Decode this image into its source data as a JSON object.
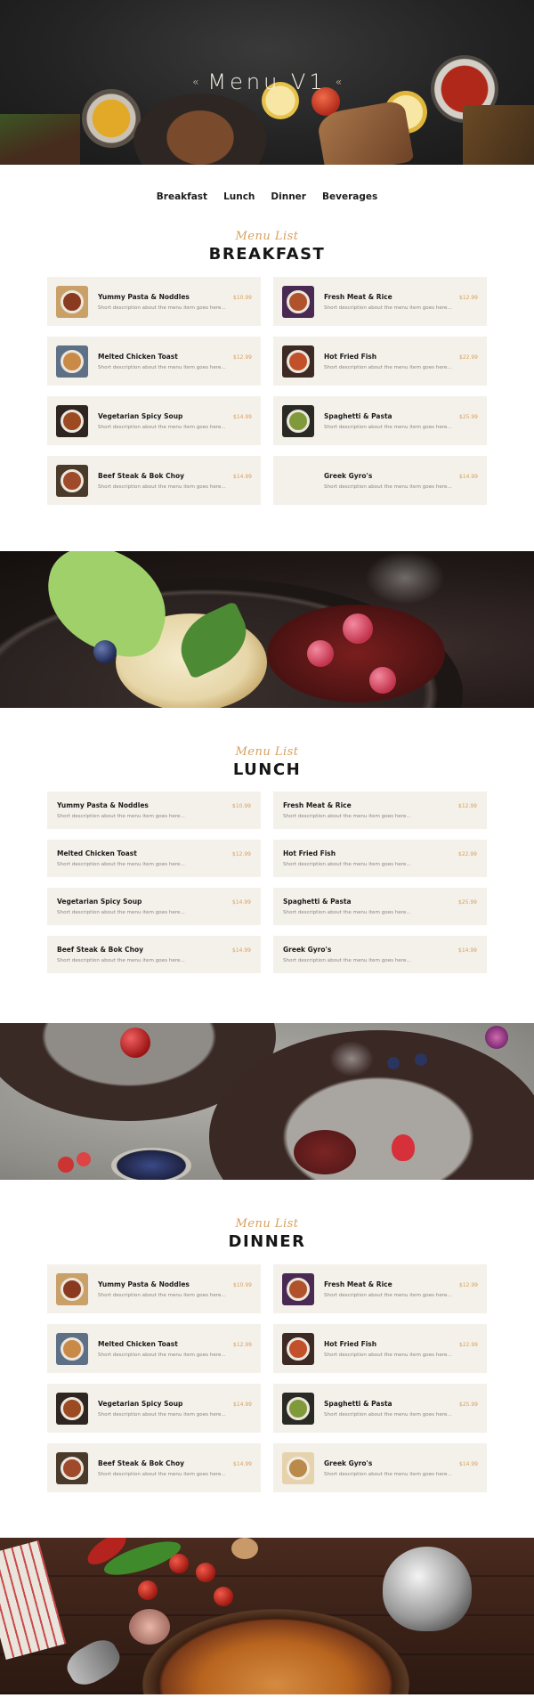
{
  "hero": {
    "title": "Menu V1",
    "ornament_left": "«",
    "ornament_right": "«"
  },
  "nav": {
    "items": [
      "Breakfast",
      "Lunch",
      "Dinner",
      "Beverages"
    ]
  },
  "sections": [
    {
      "kicker": "Menu List",
      "title": "BREAKFAST",
      "items": [
        {
          "name": "Yummy Pasta & Noddles",
          "price": "$10.99",
          "desc": "Short description about the menu item goes here..."
        },
        {
          "name": "Fresh Meat & Rice",
          "price": "$12.99",
          "desc": "Short description about the menu item goes here..."
        },
        {
          "name": "Melted Chicken Toast",
          "price": "$12.99",
          "desc": "Short description about the menu item goes here..."
        },
        {
          "name": "Hot Fried Fish",
          "price": "$22.99",
          "desc": "Short description about the menu item goes here..."
        },
        {
          "name": "Vegetarian Spicy Soup",
          "price": "$14.99",
          "desc": "Short description about the menu item goes here..."
        },
        {
          "name": "Spaghetti & Pasta",
          "price": "$25.99",
          "desc": "Short description about the menu item goes here..."
        },
        {
          "name": "Beef Steak & Bok Choy",
          "price": "$14.99",
          "desc": "Short description about the menu item goes here..."
        },
        {
          "name": "Greek Gyro's",
          "price": "$14.99",
          "desc": "Short description about the menu item goes here..."
        }
      ]
    },
    {
      "kicker": "Menu List",
      "title": "LUNCH",
      "items": [
        {
          "name": "Yummy Pasta & Noddles",
          "price": "$10.99",
          "desc": "Short description about the menu item goes here..."
        },
        {
          "name": "Fresh Meat & Rice",
          "price": "$12.99",
          "desc": "Short description about the menu item goes here..."
        },
        {
          "name": "Melted Chicken Toast",
          "price": "$12.99",
          "desc": "Short description about the menu item goes here..."
        },
        {
          "name": "Hot Fried Fish",
          "price": "$22.99",
          "desc": "Short description about the menu item goes here..."
        },
        {
          "name": "Vegetarian Spicy Soup",
          "price": "$14.99",
          "desc": "Short description about the menu item goes here..."
        },
        {
          "name": "Spaghetti & Pasta",
          "price": "$25.99",
          "desc": "Short description about the menu item goes here..."
        },
        {
          "name": "Beef Steak & Bok Choy",
          "price": "$14.99",
          "desc": "Short description about the menu item goes here..."
        },
        {
          "name": "Greek Gyro's",
          "price": "$14.99",
          "desc": "Short description about the menu item goes here..."
        }
      ]
    },
    {
      "kicker": "Menu List",
      "title": "DINNER",
      "items": [
        {
          "name": "Yummy Pasta & Noddles",
          "price": "$10.99",
          "desc": "Short description about the menu item goes here..."
        },
        {
          "name": "Fresh Meat & Rice",
          "price": "$12.99",
          "desc": "Short description about the menu item goes here..."
        },
        {
          "name": "Melted Chicken Toast",
          "price": "$12.99",
          "desc": "Short description about the menu item goes here..."
        },
        {
          "name": "Hot Fried Fish",
          "price": "$22.99",
          "desc": "Short description about the menu item goes here..."
        },
        {
          "name": "Vegetarian Spicy Soup",
          "price": "$14.99",
          "desc": "Short description about the menu item goes here..."
        },
        {
          "name": "Spaghetti & Pasta",
          "price": "$25.99",
          "desc": "Short description about the menu item goes here..."
        },
        {
          "name": "Beef Steak & Bok Choy",
          "price": "$14.99",
          "desc": "Short description about the menu item goes here..."
        },
        {
          "name": "Greek Gyro's",
          "price": "$14.99",
          "desc": "Short description about the menu item goes here..."
        }
      ]
    }
  ],
  "colors": {
    "accent": "#d8a05d",
    "card_bg": "#f4f1eb",
    "title": "#161616",
    "hero_bg": "#242424"
  }
}
